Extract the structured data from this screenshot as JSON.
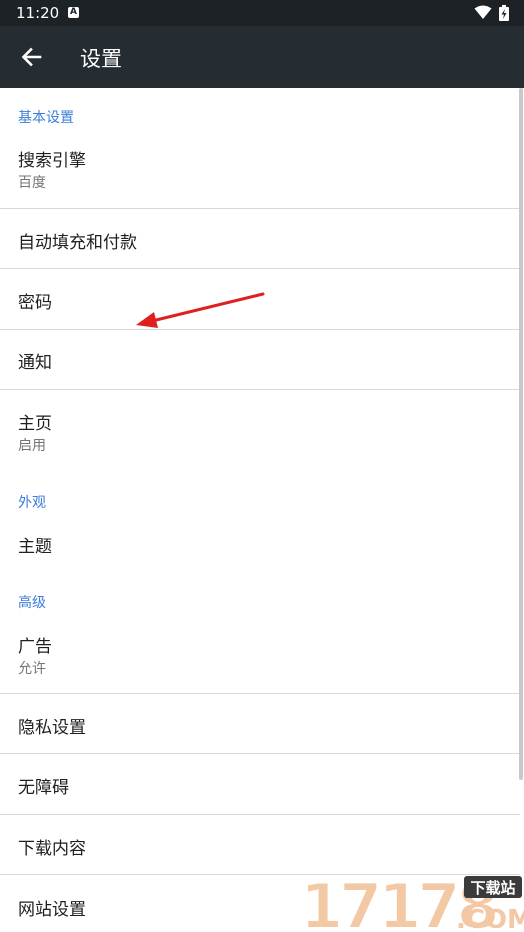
{
  "status_bar": {
    "time": "11:20",
    "notification_icon": "A",
    "icons": [
      "wifi-icon",
      "battery-icon"
    ]
  },
  "app_bar": {
    "title": "设置",
    "back_icon": "arrow-left-icon"
  },
  "sections": {
    "basic": {
      "header": "基本设置"
    },
    "appearance": {
      "header": "外观"
    },
    "advanced": {
      "header": "高级"
    }
  },
  "items": {
    "search_engine": {
      "title": "搜索引擎",
      "summary": "百度"
    },
    "autofill": {
      "title": "自动填充和付款"
    },
    "passwords": {
      "title": "密码"
    },
    "notifications": {
      "title": "通知"
    },
    "homepage": {
      "title": "主页",
      "summary": "启用"
    },
    "theme": {
      "title": "主题"
    },
    "ads": {
      "title": "广告",
      "summary": "允许"
    },
    "privacy": {
      "title": "隐私设置"
    },
    "accessibility": {
      "title": "无障碍"
    },
    "downloads": {
      "title": "下载内容"
    },
    "site_settings": {
      "title": "网站设置"
    }
  },
  "watermark": {
    "number": "17178",
    "tag": "下载站",
    "domain": ".COM"
  },
  "colors": {
    "status_bar": "#1d2226",
    "app_bar": "#252d32",
    "section_header": "#3b7ddb",
    "annotation_arrow": "#e02020"
  }
}
